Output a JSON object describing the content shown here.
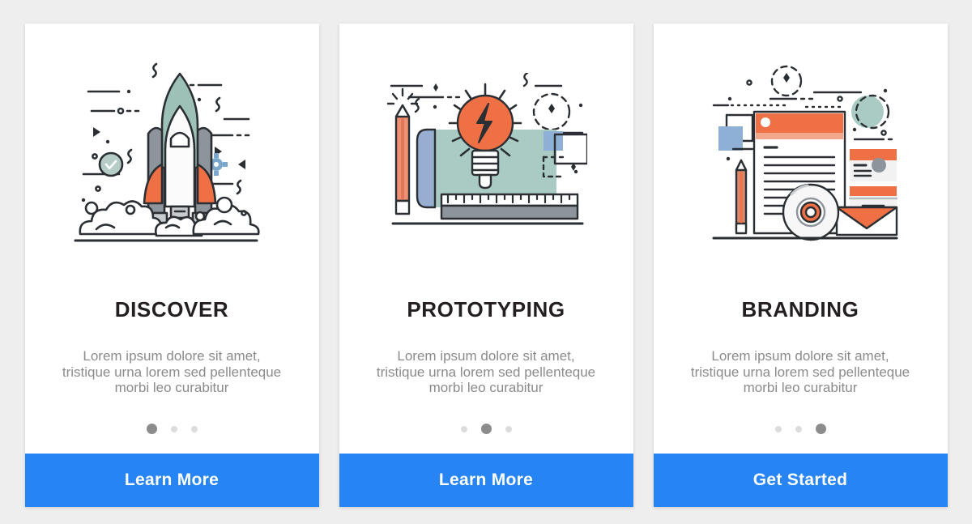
{
  "background_color": "#eeeeee",
  "accent_blue": "#2684f5",
  "accent_orange": "#ef7044",
  "accent_mint": "#9dc1b7",
  "accent_gray": "#8d949b",
  "title_color": "#231f20",
  "body_color": "#8b8b8b",
  "cards": [
    {
      "illustration": "rocket-launch-illustration",
      "title": "DISCOVER",
      "description": "Lorem ipsum dolore sit amet,\ntristique urna lorem sed pellenteque\nmorbi leo curabitur",
      "dots": {
        "count": 3,
        "active_index": 0
      },
      "cta_label": "Learn More"
    },
    {
      "illustration": "lightbulb-blueprint-illustration",
      "title": "PROTOTYPING",
      "description": "Lorem ipsum dolore sit amet,\ntristique urna lorem sed pellenteque\nmorbi leo curabitur",
      "dots": {
        "count": 3,
        "active_index": 1
      },
      "cta_label": "Learn More"
    },
    {
      "illustration": "document-branding-illustration",
      "title": "BRANDING",
      "description": "Lorem ipsum dolore sit amet,\ntristique urna lorem sed pellenteque\nmorbi leo curabitur",
      "dots": {
        "count": 3,
        "active_index": 2
      },
      "cta_label": "Get Started"
    }
  ]
}
